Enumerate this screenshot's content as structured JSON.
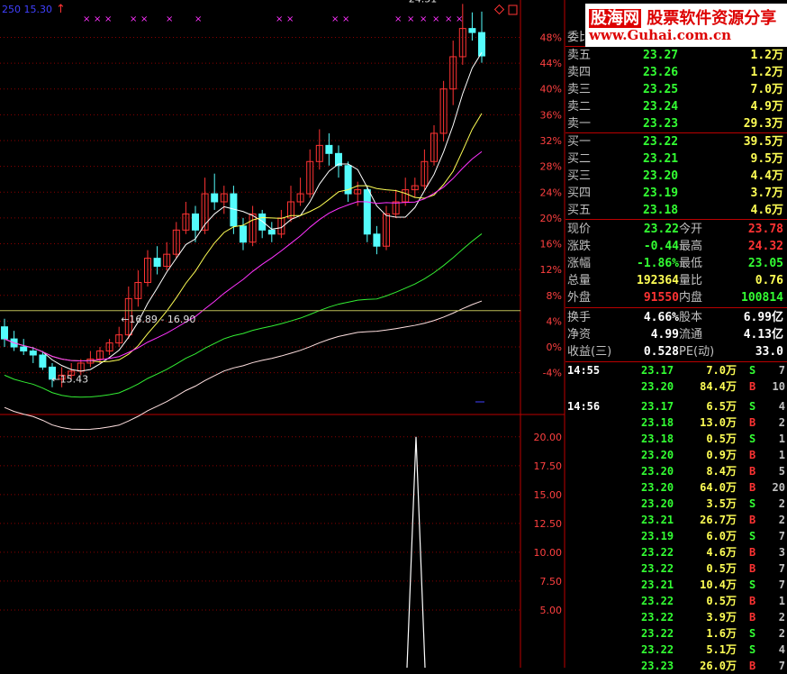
{
  "header": {
    "indicator_left": "250",
    "indicator_value": "15.30",
    "arrow_icon": "up-arrow-icon"
  },
  "watermark": {
    "title": "股海网",
    "subtitle": "股票软件资源分享",
    "url": "www.Guhai.com.cn"
  },
  "chart_data": [
    {
      "type": "candlestick",
      "title": "",
      "y_axis_labels": [
        "48%",
        "44%",
        "40%",
        "36%",
        "32%",
        "28%",
        "24%",
        "20%",
        "16%",
        "12%",
        "8%",
        "4%",
        "0%",
        "-4%"
      ],
      "ylim_pct": [
        -6,
        51
      ],
      "base_price": 16.0,
      "annotations": {
        "high": "24.51",
        "low": "15.43",
        "range": "16.89 - 16.90"
      },
      "candles": [
        {
          "o": 16.5,
          "c": 16.2,
          "h": 16.7,
          "l": 16.0
        },
        {
          "o": 16.2,
          "c": 16.0,
          "h": 16.4,
          "l": 15.9
        },
        {
          "o": 16.0,
          "c": 15.9,
          "h": 16.2,
          "l": 15.8
        },
        {
          "o": 15.9,
          "c": 15.8,
          "h": 16.0,
          "l": 15.6
        },
        {
          "o": 15.8,
          "c": 15.5,
          "h": 15.9,
          "l": 15.43
        },
        {
          "o": 15.5,
          "c": 15.2,
          "h": 15.6,
          "l": 15.0
        },
        {
          "o": 15.2,
          "c": 15.3,
          "h": 15.5,
          "l": 15.0
        },
        {
          "o": 15.3,
          "c": 15.4,
          "h": 15.6,
          "l": 15.2
        },
        {
          "o": 15.4,
          "c": 15.6,
          "h": 15.7,
          "l": 15.3
        },
        {
          "o": 15.6,
          "c": 15.7,
          "h": 15.9,
          "l": 15.5
        },
        {
          "o": 15.7,
          "c": 15.9,
          "h": 16.0,
          "l": 15.6
        },
        {
          "o": 15.9,
          "c": 16.1,
          "h": 16.2,
          "l": 15.8
        },
        {
          "o": 16.1,
          "c": 16.3,
          "h": 16.5,
          "l": 16.0
        },
        {
          "o": 16.3,
          "c": 17.2,
          "h": 17.5,
          "l": 16.2
        },
        {
          "o": 17.2,
          "c": 17.6,
          "h": 17.9,
          "l": 17.0
        },
        {
          "o": 17.6,
          "c": 18.2,
          "h": 18.4,
          "l": 17.5
        },
        {
          "o": 18.2,
          "c": 18.0,
          "h": 18.5,
          "l": 17.8
        },
        {
          "o": 18.0,
          "c": 18.3,
          "h": 18.6,
          "l": 17.9
        },
        {
          "o": 18.3,
          "c": 18.9,
          "h": 19.1,
          "l": 18.2
        },
        {
          "o": 18.9,
          "c": 19.3,
          "h": 19.6,
          "l": 18.8
        },
        {
          "o": 19.3,
          "c": 18.9,
          "h": 19.5,
          "l": 18.6
        },
        {
          "o": 18.9,
          "c": 19.8,
          "h": 20.2,
          "l": 18.8
        },
        {
          "o": 19.8,
          "c": 19.6,
          "h": 20.3,
          "l": 19.4
        },
        {
          "o": 19.6,
          "c": 19.8,
          "h": 20.0,
          "l": 19.3
        },
        {
          "o": 19.8,
          "c": 19.0,
          "h": 20.0,
          "l": 18.8
        },
        {
          "o": 19.0,
          "c": 18.6,
          "h": 19.2,
          "l": 18.4
        },
        {
          "o": 18.6,
          "c": 19.3,
          "h": 19.5,
          "l": 18.5
        },
        {
          "o": 19.3,
          "c": 18.9,
          "h": 19.4,
          "l": 18.7
        },
        {
          "o": 18.9,
          "c": 18.8,
          "h": 19.1,
          "l": 18.6
        },
        {
          "o": 18.8,
          "c": 19.2,
          "h": 19.4,
          "l": 18.7
        },
        {
          "o": 19.2,
          "c": 19.6,
          "h": 20.0,
          "l": 19.1
        },
        {
          "o": 19.6,
          "c": 19.8,
          "h": 20.2,
          "l": 19.5
        },
        {
          "o": 19.8,
          "c": 20.6,
          "h": 20.9,
          "l": 19.7
        },
        {
          "o": 20.6,
          "c": 21.0,
          "h": 21.4,
          "l": 20.4
        },
        {
          "o": 21.0,
          "c": 20.8,
          "h": 21.3,
          "l": 20.5
        },
        {
          "o": 20.8,
          "c": 20.5,
          "h": 21.0,
          "l": 20.2
        },
        {
          "o": 20.5,
          "c": 19.8,
          "h": 20.6,
          "l": 19.6
        },
        {
          "o": 19.8,
          "c": 19.9,
          "h": 20.1,
          "l": 19.5
        },
        {
          "o": 19.9,
          "c": 18.8,
          "h": 20.0,
          "l": 18.6
        },
        {
          "o": 18.8,
          "c": 18.5,
          "h": 19.0,
          "l": 18.3
        },
        {
          "o": 18.5,
          "c": 19.3,
          "h": 19.5,
          "l": 18.4
        },
        {
          "o": 19.3,
          "c": 19.6,
          "h": 19.9,
          "l": 19.2
        },
        {
          "o": 19.6,
          "c": 19.9,
          "h": 20.2,
          "l": 19.5
        },
        {
          "o": 19.9,
          "c": 20.0,
          "h": 20.2,
          "l": 19.7
        },
        {
          "o": 20.0,
          "c": 20.6,
          "h": 20.9,
          "l": 19.9
        },
        {
          "o": 20.6,
          "c": 21.3,
          "h": 21.5,
          "l": 20.5
        },
        {
          "o": 21.3,
          "c": 22.4,
          "h": 22.6,
          "l": 21.1
        },
        {
          "o": 22.4,
          "c": 23.2,
          "h": 23.6,
          "l": 22.0
        },
        {
          "o": 23.2,
          "c": 23.9,
          "h": 24.51,
          "l": 23.0
        },
        {
          "o": 23.9,
          "c": 23.8,
          "h": 24.3,
          "l": 23.6
        },
        {
          "o": 23.8,
          "c": 23.22,
          "h": 24.32,
          "l": 23.05
        }
      ]
    },
    {
      "type": "volume-indicator",
      "title": "",
      "y_axis_labels": [
        "20.00",
        "17.50",
        "15.00",
        "12.50",
        "10.00",
        "7.50",
        "5.00"
      ],
      "ylim": [
        0,
        21
      ],
      "spike_value": 20.0
    }
  ],
  "quote": {
    "header_label": "委比",
    "ask": [
      {
        "label": "卖五",
        "price": "23.27",
        "vol": "1.2万"
      },
      {
        "label": "卖四",
        "price": "23.26",
        "vol": "1.2万"
      },
      {
        "label": "卖三",
        "price": "23.25",
        "vol": "7.0万"
      },
      {
        "label": "卖二",
        "price": "23.24",
        "vol": "4.9万"
      },
      {
        "label": "卖一",
        "price": "23.23",
        "vol": "29.3万"
      }
    ],
    "bid": [
      {
        "label": "买一",
        "price": "23.22",
        "vol": "39.5万"
      },
      {
        "label": "买二",
        "price": "23.21",
        "vol": "9.5万"
      },
      {
        "label": "买三",
        "price": "23.20",
        "vol": "4.4万"
      },
      {
        "label": "买四",
        "price": "23.19",
        "vol": "3.7万"
      },
      {
        "label": "买五",
        "price": "23.18",
        "vol": "4.6万"
      }
    ],
    "stats": [
      {
        "l1": "现价",
        "v1": "23.22",
        "c1": "#33ff33",
        "l2": "今开",
        "v2": "23.78",
        "c2": "#ff3333"
      },
      {
        "l1": "涨跌",
        "v1": "-0.44",
        "c1": "#33ff33",
        "l2": "最高",
        "v2": "24.32",
        "c2": "#ff3333"
      },
      {
        "l1": "涨幅",
        "v1": "-1.86%",
        "c1": "#33ff33",
        "l2": "最低",
        "v2": "23.05",
        "c2": "#33ff33"
      },
      {
        "l1": "总量",
        "v1": "192364",
        "c1": "#ffff55",
        "l2": "量比",
        "v2": "0.76",
        "c2": "#ffff55"
      },
      {
        "l1": "外盘",
        "v1": "91550",
        "c1": "#ff3333",
        "l2": "内盘",
        "v2": "100814",
        "c2": "#33ff33"
      }
    ],
    "fundamentals": [
      {
        "l1": "换手",
        "v1": "4.66%",
        "l2": "股本",
        "v2": "6.99亿"
      },
      {
        "l1": "净资",
        "v1": "4.99",
        "l2": "流通",
        "v2": "4.13亿"
      },
      {
        "l1": "收益(三)",
        "v1": "0.528",
        "l2": "PE(动)",
        "v2": "33.0"
      }
    ]
  },
  "trades": [
    {
      "time": "14:55",
      "price": "23.17",
      "vol": "7.0万",
      "side": "S",
      "n": "7"
    },
    {
      "time": "",
      "price": "23.20",
      "vol": "84.4万",
      "side": "B",
      "n": "10"
    },
    {
      "time": "14:56",
      "price": "23.17",
      "vol": "6.5万",
      "side": "S",
      "n": "4"
    },
    {
      "time": "",
      "price": "23.18",
      "vol": "13.0万",
      "side": "B",
      "n": "2"
    },
    {
      "time": "",
      "price": "23.18",
      "vol": "0.5万",
      "side": "S",
      "n": "1"
    },
    {
      "time": "",
      "price": "23.20",
      "vol": "0.9万",
      "side": "B",
      "n": "1"
    },
    {
      "time": "",
      "price": "23.20",
      "vol": "8.4万",
      "side": "B",
      "n": "5"
    },
    {
      "time": "",
      "price": "23.20",
      "vol": "64.0万",
      "side": "B",
      "n": "20"
    },
    {
      "time": "",
      "price": "23.20",
      "vol": "3.5万",
      "side": "S",
      "n": "2"
    },
    {
      "time": "",
      "price": "23.21",
      "vol": "26.7万",
      "side": "B",
      "n": "2"
    },
    {
      "time": "",
      "price": "23.19",
      "vol": "6.0万",
      "side": "S",
      "n": "7"
    },
    {
      "time": "",
      "price": "23.22",
      "vol": "4.6万",
      "side": "B",
      "n": "3"
    },
    {
      "time": "",
      "price": "23.22",
      "vol": "0.5万",
      "side": "B",
      "n": "7"
    },
    {
      "time": "",
      "price": "23.21",
      "vol": "10.4万",
      "side": "S",
      "n": "7"
    },
    {
      "time": "",
      "price": "23.22",
      "vol": "0.5万",
      "side": "B",
      "n": "1"
    },
    {
      "time": "",
      "price": "23.22",
      "vol": "3.9万",
      "side": "B",
      "n": "2"
    },
    {
      "time": "",
      "price": "23.22",
      "vol": "1.6万",
      "side": "S",
      "n": "2"
    },
    {
      "time": "",
      "price": "23.22",
      "vol": "5.1万",
      "side": "S",
      "n": "4"
    },
    {
      "time": "",
      "price": "23.23",
      "vol": "26.0万",
      "side": "B",
      "n": "7"
    }
  ],
  "colors": {
    "up": "#ff3333",
    "down": "#54fcfc",
    "grid": "#8b0000",
    "price_green": "#33ff33",
    "vol_yellow": "#ffff55"
  }
}
